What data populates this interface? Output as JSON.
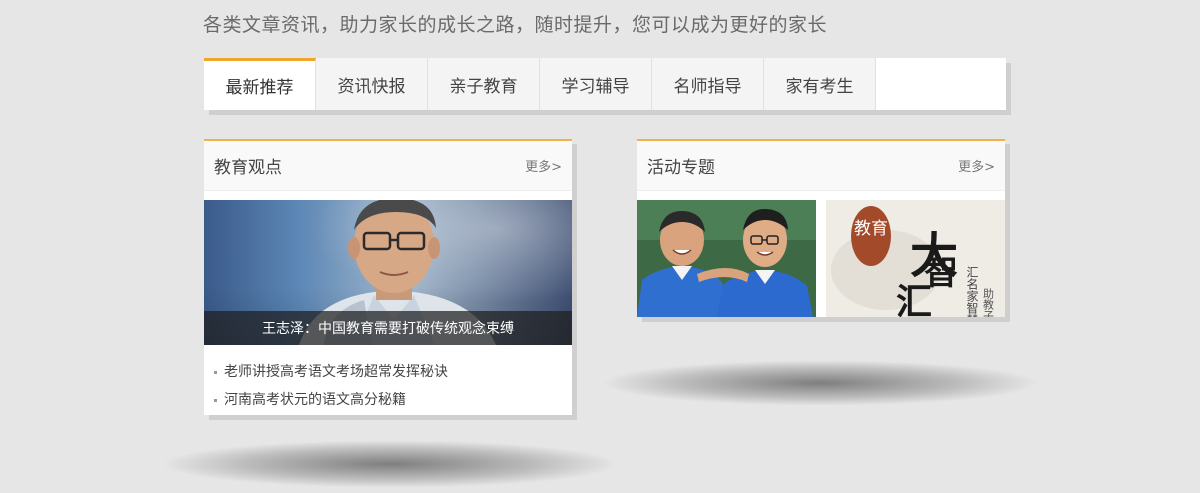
{
  "tagline": "各类文章资讯，助力家长的成长之路，随时提升，您可以成为更好的家长",
  "tabs": [
    {
      "label": "最新推荐",
      "active": true
    },
    {
      "label": "资讯快报",
      "active": false
    },
    {
      "label": "亲子教育",
      "active": false
    },
    {
      "label": "学习辅导",
      "active": false
    },
    {
      "label": "名师指导",
      "active": false
    },
    {
      "label": "家有考生",
      "active": false
    }
  ],
  "education_views": {
    "title": "教育观点",
    "more": "更多>",
    "feature_caption": "王志泽：中国教育需要打破传统观念束缚",
    "articles": [
      "老师讲授高考语文考场超常发挥秘诀",
      "河南高考状元的语文高分秘籍"
    ]
  },
  "events": {
    "title": "活动专题",
    "more": "更多>",
    "promo_brand": {
      "main_chars": [
        "大",
        "智",
        "汇"
      ],
      "seal": "教育",
      "side_text": "汇名家智慧",
      "side_text_2": "助教子"
    }
  },
  "colors": {
    "accent": "#f0a62a",
    "background": "#e6e6e6"
  }
}
